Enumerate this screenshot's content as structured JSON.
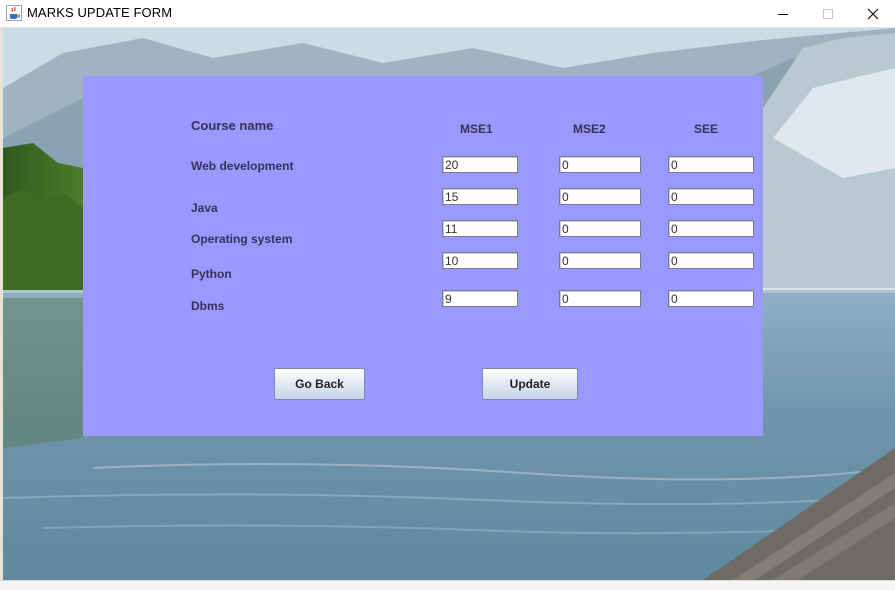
{
  "window": {
    "title": "MARKS UPDATE FORM",
    "app_icon": "java-cup-icon",
    "controls": [
      "minimize-icon",
      "maximize-icon",
      "close-icon"
    ]
  },
  "form": {
    "headers": {
      "course": "Course name",
      "mse1": "MSE1",
      "mse2": "MSE2",
      "see": "SEE"
    },
    "rows": [
      {
        "course": "Web development",
        "mse1": "20",
        "mse2": "0",
        "see": "0"
      },
      {
        "course": "Java",
        "mse1": "15",
        "mse2": "0",
        "see": "0"
      },
      {
        "course": "Operating system",
        "mse1": "11",
        "mse2": "0",
        "see": "0"
      },
      {
        "course": "Python",
        "mse1": "10",
        "mse2": "0",
        "see": "0"
      },
      {
        "course": "Dbms",
        "mse1": "9",
        "mse2": "0",
        "see": "0"
      }
    ],
    "buttons": {
      "back": "Go Back",
      "update": "Update"
    }
  },
  "colors": {
    "panel": "#9999ff",
    "label_text": "#333355"
  }
}
